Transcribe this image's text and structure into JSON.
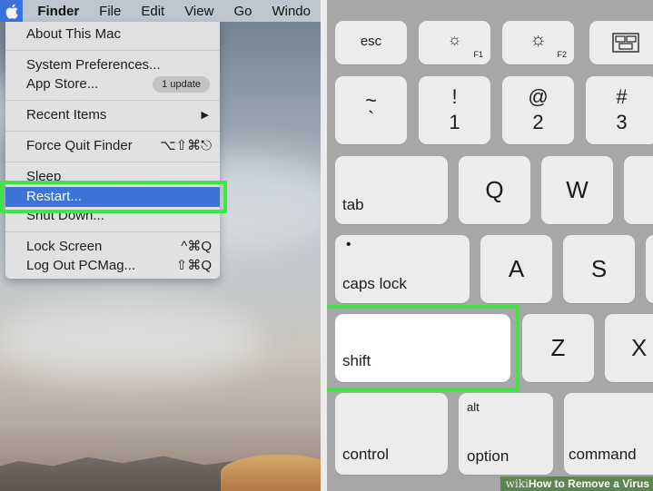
{
  "menubar": {
    "app_name": "Finder",
    "items": [
      "File",
      "Edit",
      "View",
      "Go",
      "Windo"
    ]
  },
  "apple_menu": {
    "items": {
      "about": "About This Mac",
      "prefs": "System Preferences...",
      "store": "App Store...",
      "store_badge": "1 update",
      "recent": "Recent Items",
      "recent_arrow": "▶",
      "force_quit": "Force Quit Finder",
      "force_quit_shortcut": "⌥⇧⌘⎋",
      "sleep": "Sleep",
      "restart": "Restart...",
      "shutdown": "Shut Down...",
      "lock": "Lock Screen",
      "lock_shortcut": "^⌘Q",
      "logout": "Log Out PCMag...",
      "logout_shortcut": "⇧⌘Q"
    }
  },
  "keyboard": {
    "esc": "esc",
    "f1_icon": "☼",
    "f1": "F1",
    "f2_icon": "☼",
    "f2": "F2",
    "tilde_top": "~",
    "tilde_bottom": "`",
    "k1_top": "!",
    "k1_bottom": "1",
    "k2_top": "@",
    "k2_bottom": "2",
    "k3_top": "#",
    "k3_bottom": "3",
    "tab": "tab",
    "q": "Q",
    "w": "W",
    "caps_dot": "•",
    "caps": "caps lock",
    "a": "A",
    "s": "S",
    "shift": "shift",
    "z": "Z",
    "x": "X",
    "control": "control",
    "alt": "alt",
    "option": "option",
    "command": "command"
  },
  "watermark": {
    "brand": "wiki",
    "title": "How to Remove a Virus"
  },
  "colors": {
    "highlight_green": "#3ee642",
    "menu_selection": "#3c74d7"
  }
}
